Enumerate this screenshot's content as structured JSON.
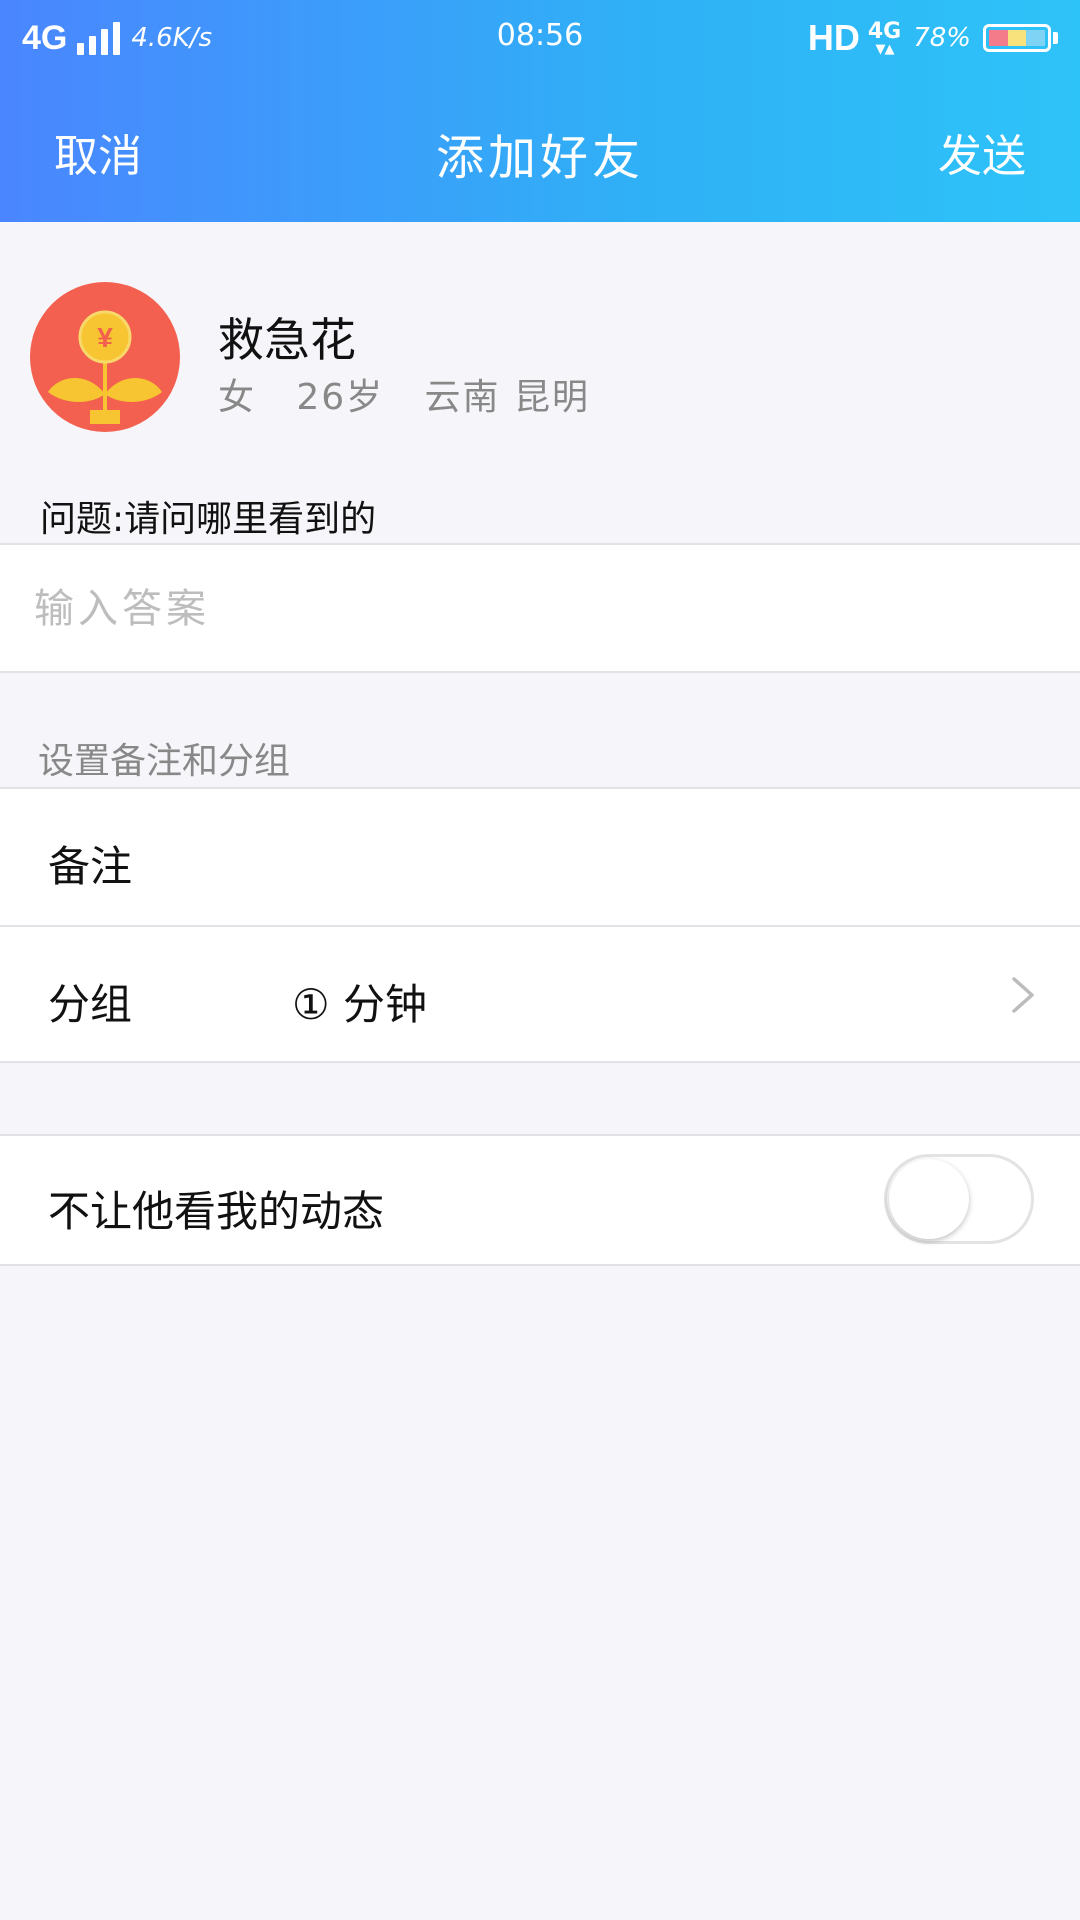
{
  "status_bar": {
    "network": "4G",
    "speed": "4.6K/s",
    "time": "08:56",
    "hd": "HD",
    "network2": "4G",
    "battery_pct": "78%"
  },
  "nav": {
    "cancel": "取消",
    "title": "添加好友",
    "send": "发送"
  },
  "profile": {
    "name": "救急花",
    "gender": "女",
    "age": "26岁",
    "location": "云南 昆明",
    "avatar_icon": "money-plant-icon"
  },
  "question": {
    "label": "问题:请问哪里看到的",
    "answer_placeholder": "输入答案"
  },
  "settings": {
    "section_label": "设置备注和分组",
    "remark_label": "备注",
    "group_label": "分组",
    "group_value": "① 分钟"
  },
  "privacy": {
    "hide_moments_label": "不让他看我的动态",
    "hide_moments_enabled": false
  },
  "colors": {
    "header_start": "#4a86ff",
    "header_end": "#2ec3f8",
    "avatar_bg": "#f4604f",
    "coin": "#f7c531"
  }
}
